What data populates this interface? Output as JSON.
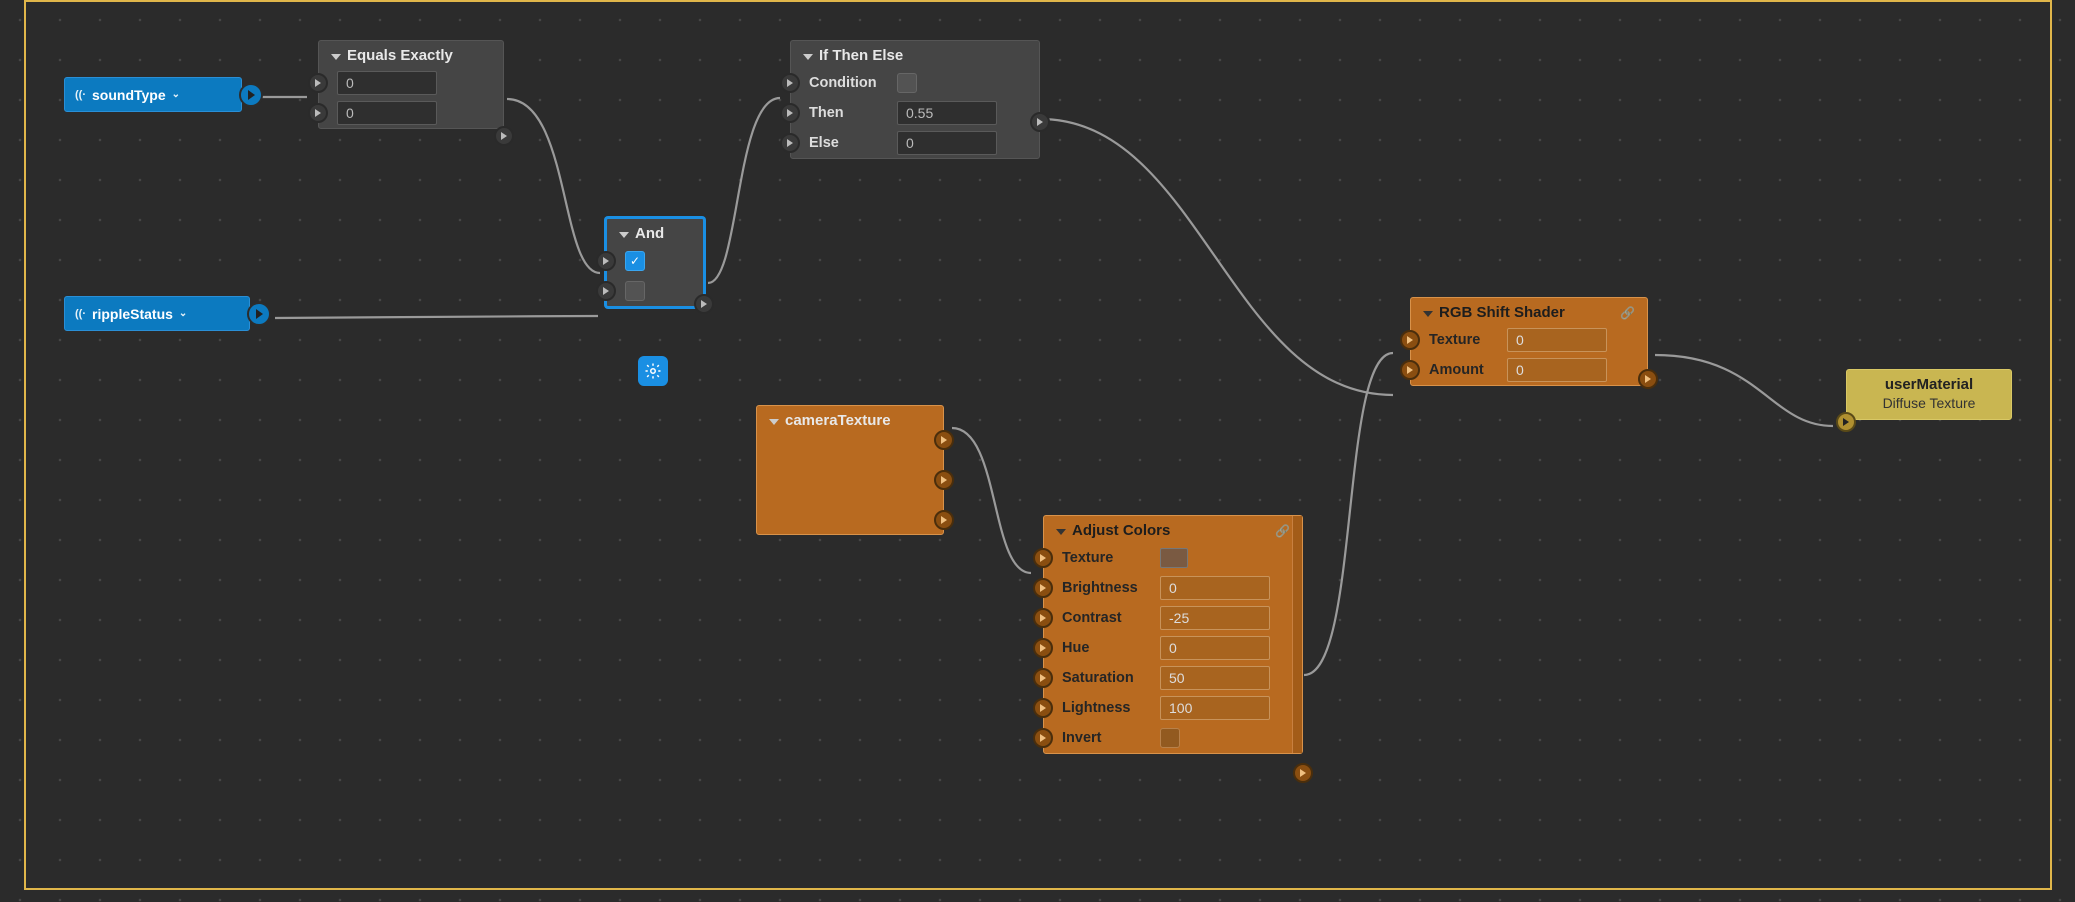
{
  "frame": {
    "active": true
  },
  "vars": {
    "soundType": {
      "label": "soundType"
    },
    "rippleStatus": {
      "label": "rippleStatus"
    }
  },
  "nodes": {
    "equals": {
      "title": "Equals Exactly",
      "a": "0",
      "b": "0"
    },
    "and": {
      "title": "And",
      "a_checked": true,
      "b_checked": false
    },
    "ifthen": {
      "title": "If Then Else",
      "condition_label": "Condition",
      "then_label": "Then",
      "else_label": "Else",
      "then_val": "0.55",
      "else_val": "0"
    },
    "cameraTexture": {
      "title": "cameraTexture"
    },
    "adjustColors": {
      "title": "Adjust Colors",
      "texture_label": "Texture",
      "brightness_label": "Brightness",
      "brightness": "0",
      "contrast_label": "Contrast",
      "contrast": "-25",
      "hue_label": "Hue",
      "hue": "0",
      "saturation_label": "Saturation",
      "saturation": "50",
      "lightness_label": "Lightness",
      "lightness": "100",
      "invert_label": "Invert"
    },
    "rgbshift": {
      "title": "RGB Shift Shader",
      "texture_label": "Texture",
      "texture_val": "0",
      "amount_label": "Amount",
      "amount_val": "0"
    },
    "userMaterial": {
      "title": "userMaterial",
      "sub": "Diffuse Texture"
    }
  }
}
